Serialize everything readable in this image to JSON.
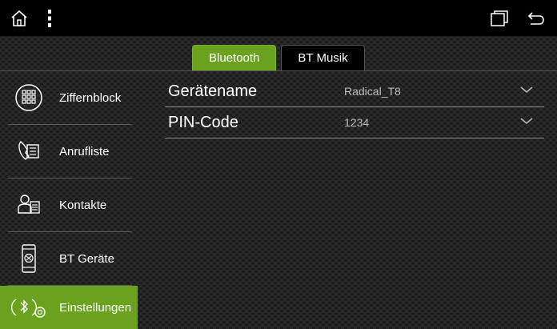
{
  "topbar": {
    "icons": [
      "home-icon",
      "more-icon",
      "recent-apps-icon",
      "back-icon"
    ]
  },
  "tabs": [
    {
      "label": "Bluetooth",
      "active": true
    },
    {
      "label": "BT Musik",
      "active": false
    }
  ],
  "sidebar": {
    "items": [
      {
        "label": "Ziffernblock",
        "icon": "dialpad-icon",
        "active": false
      },
      {
        "label": "Anrufliste",
        "icon": "call-log-icon",
        "active": false
      },
      {
        "label": "Kontakte",
        "icon": "contacts-icon",
        "active": false
      },
      {
        "label": "BT Geräte",
        "icon": "bt-devices-icon",
        "active": false
      },
      {
        "label": "Einstellungen",
        "icon": "bt-settings-icon",
        "active": true
      }
    ]
  },
  "settings": {
    "rows": [
      {
        "label": "Gerätename",
        "value": "Radical_T8"
      },
      {
        "label": "PIN-Code",
        "value": "1234"
      }
    ]
  },
  "colors": {
    "accent": "#6aa220",
    "background": "#151515",
    "divider": "#8a8a8a"
  }
}
